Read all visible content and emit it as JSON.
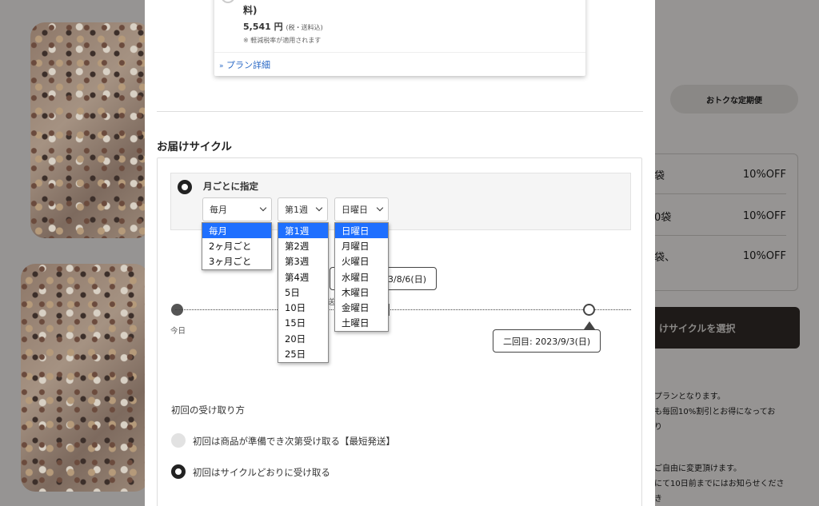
{
  "background": {
    "tab_label": "おトクな定期便",
    "rows": [
      {
        "label": "袋",
        "value": "10%OFF"
      },
      {
        "label": "0袋",
        "value": "10%OFF"
      },
      {
        "label": "袋、",
        "value": "10%OFF"
      }
    ],
    "select_button": "けサイクルを選択",
    "notes": [
      "プランとなります。",
      "も毎回10%割引とお得になってお",
      "り",
      "ご自由に変更頂けます。",
      "にて10日前までにはお知らせくださ",
      "き"
    ]
  },
  "plan": {
    "title_fragment": "料)",
    "price": "5,541",
    "price_unit": "円",
    "price_note": "(税・送料込)",
    "tax_note": "※ 軽減税率が適用されます",
    "detail_link": "プラン詳細",
    "detail_icon": "double-chevron-down-icon"
  },
  "section_title": "お届けサイクル",
  "cycle_option": {
    "label": "月ごとに指定",
    "selects": {
      "frequency": {
        "value": "毎月",
        "options": [
          "毎月",
          "2ヶ月ごと",
          "3ヶ月ごと"
        ]
      },
      "week": {
        "value": "第1週",
        "options": [
          "第1週",
          "第2週",
          "第3週",
          "第4週",
          "5日",
          "10日",
          "15日",
          "20日",
          "25日"
        ]
      },
      "weekday": {
        "value": "日曜日",
        "options": [
          "日曜日",
          "月曜日",
          "火曜日",
          "水曜日",
          "木曜日",
          "金曜日",
          "土曜日"
        ]
      }
    }
  },
  "timeline": {
    "today_label": "今日",
    "first_tooltip_fragment": "3/8/6(日)",
    "second_tooltip": "二回目: 2023/9/3(日)",
    "mid_fragment": "送"
  },
  "first_receipt": {
    "title": "初回の受け取り方",
    "options": [
      {
        "label": "初回は商品が準備でき次第受け取る【最短発送】",
        "selected": false
      },
      {
        "label": "初回はサイクルどおりに受け取る",
        "selected": true
      }
    ]
  }
}
